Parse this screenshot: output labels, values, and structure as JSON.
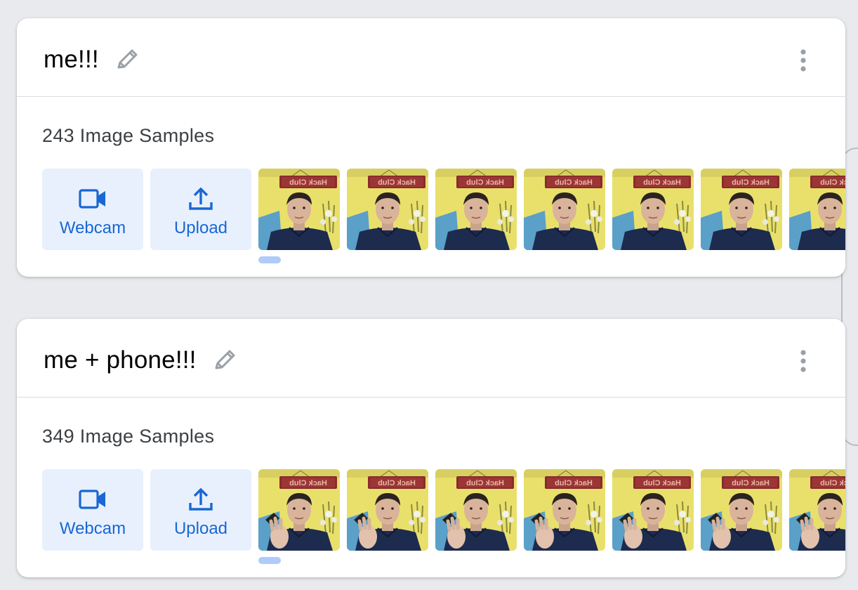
{
  "classes": [
    {
      "name": "me!!!",
      "sample_count_label": "243 Image Samples",
      "webcam_label": "Webcam",
      "upload_label": "Upload",
      "variant": "no-phone"
    },
    {
      "name": "me + phone!!!",
      "sample_count_label": "349 Image Samples",
      "webcam_label": "Webcam",
      "upload_label": "Upload",
      "variant": "phone"
    }
  ],
  "thumbnail_sign_text": "Hack Club",
  "icons": {
    "edit": "pencil-icon",
    "more": "more-vert-icon",
    "webcam": "videocam-icon",
    "upload": "upload-icon"
  },
  "colors": {
    "accent": "#1967d2",
    "button_bg": "#e8f0fe",
    "indicator": "#aecbfa",
    "background": "#e8eaed"
  }
}
